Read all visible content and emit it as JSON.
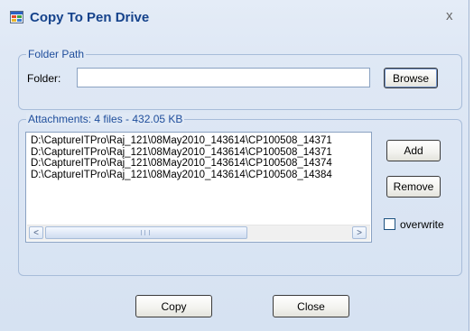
{
  "window": {
    "title": "Copy To Pen Drive",
    "close_glyph": "x"
  },
  "folder_group": {
    "legend": "Folder Path",
    "folder_label": "Folder:",
    "folder_value": "",
    "browse_label": "Browse"
  },
  "attachments_group": {
    "legend": "Attachments: 4 files - 432.05 KB",
    "items": [
      "D:\\CaptureITPro\\Raj_121\\08May2010_143614\\CP100508_14371",
      "D:\\CaptureITPro\\Raj_121\\08May2010_143614\\CP100508_14371",
      "D:\\CaptureITPro\\Raj_121\\08May2010_143614\\CP100508_14374",
      "D:\\CaptureITPro\\Raj_121\\08May2010_143614\\CP100508_14384"
    ],
    "add_label": "Add",
    "remove_label": "Remove",
    "overwrite_label": "overwrite",
    "overwrite_checked": false,
    "scroll_left_glyph": "<",
    "scroll_right_glyph": ">"
  },
  "footer": {
    "copy_label": "Copy",
    "close_label": "Close"
  }
}
